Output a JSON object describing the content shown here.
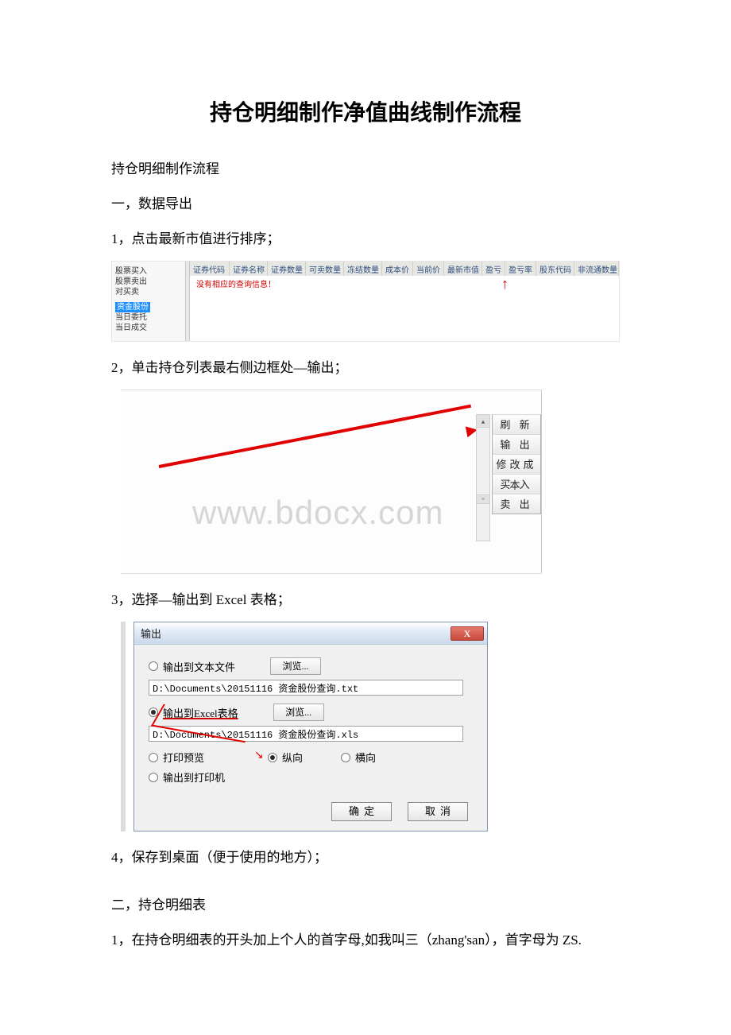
{
  "title": "持仓明细制作净值曲线制作流程",
  "intro": "持仓明细制作流程",
  "section1_heading": "一，数据导出",
  "step1_text": "1，点击最新市值进行排序；",
  "shot1": {
    "sidebar_items": [
      "股票买入",
      "股票卖出",
      "对买卖",
      "",
      "",
      "资金股份",
      "当日委托",
      "当日成交"
    ],
    "headers": [
      "证券代码",
      "证券名称",
      "证券数量",
      "可卖数量",
      "冻结数量",
      "成本价",
      "当前价",
      "最新市值",
      "盈亏",
      "盈亏率",
      "股东代码",
      "非流通数量"
    ],
    "empty_msg": "没有相应的查询信息！"
  },
  "step2_text": "2，单击持仓列表最右侧边框处—输出；",
  "shot2": {
    "btn_refresh": "刷 新",
    "btn_output": "输 出",
    "btn_modify": "修改成本",
    "btn_buy": "买 入",
    "btn_sell": "卖 出",
    "watermark": "www.bdocx.com"
  },
  "step3_text": "3，选择—输出到 Excel 表格；",
  "shot3": {
    "dialog_title": "输出",
    "opt_text": "输出到文本文件",
    "opt_excel": "输出到Excel表格",
    "opt_preview": "打印预览",
    "opt_printer": "输出到打印机",
    "opt_vertical": "纵向",
    "opt_horizontal": "横向",
    "browse": "浏览...",
    "path_txt": "D:\\Documents\\20151116 资金股份查询.txt",
    "path_xls": "D:\\Documents\\20151116 资金股份查询.xls",
    "ok": "确定",
    "cancel": "取消",
    "close": "X"
  },
  "step4_text": "4，保存到桌面（便于使用的地方）；",
  "section2_heading": "二，持仓明细表",
  "section2_step1": "1，在持仓明细表的开头加上个人的首字母,如我叫三（zhang'san），首字母为 ZS."
}
